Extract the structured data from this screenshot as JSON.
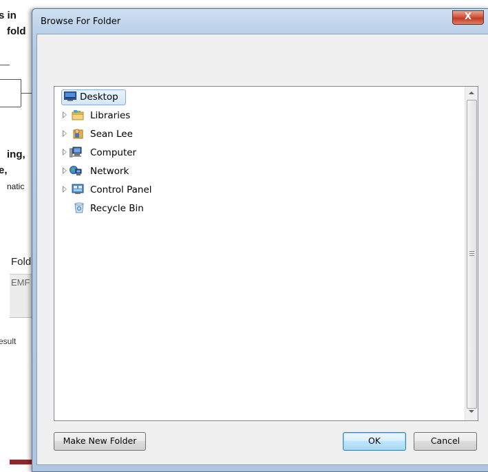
{
  "background": {
    "line1": "s in",
    "line2": "fold",
    "line3": "ing,",
    "line4": "e,",
    "line5": "natic",
    "line6": "Fold",
    "line7": "EMF",
    "line8": "esult"
  },
  "dialog": {
    "title": "Browse For Folder",
    "close_label": "X",
    "tree": [
      {
        "label": "Desktop",
        "icon": "desktop-icon",
        "selected": true
      },
      {
        "label": "Libraries",
        "icon": "libraries-icon"
      },
      {
        "label": "Sean Lee",
        "icon": "user-folder-icon"
      },
      {
        "label": "Computer",
        "icon": "computer-icon"
      },
      {
        "label": "Network",
        "icon": "network-icon"
      },
      {
        "label": "Control Panel",
        "icon": "control-panel-icon"
      },
      {
        "label": "Recycle Bin",
        "icon": "recycle-bin-icon"
      }
    ],
    "buttons": {
      "make_new_folder": "Make New Folder",
      "ok": "OK",
      "cancel": "Cancel"
    }
  },
  "colors": {
    "selection_border": "#84acdd",
    "close_button": "#c23c22",
    "window_frame": "#b3cbe6"
  }
}
